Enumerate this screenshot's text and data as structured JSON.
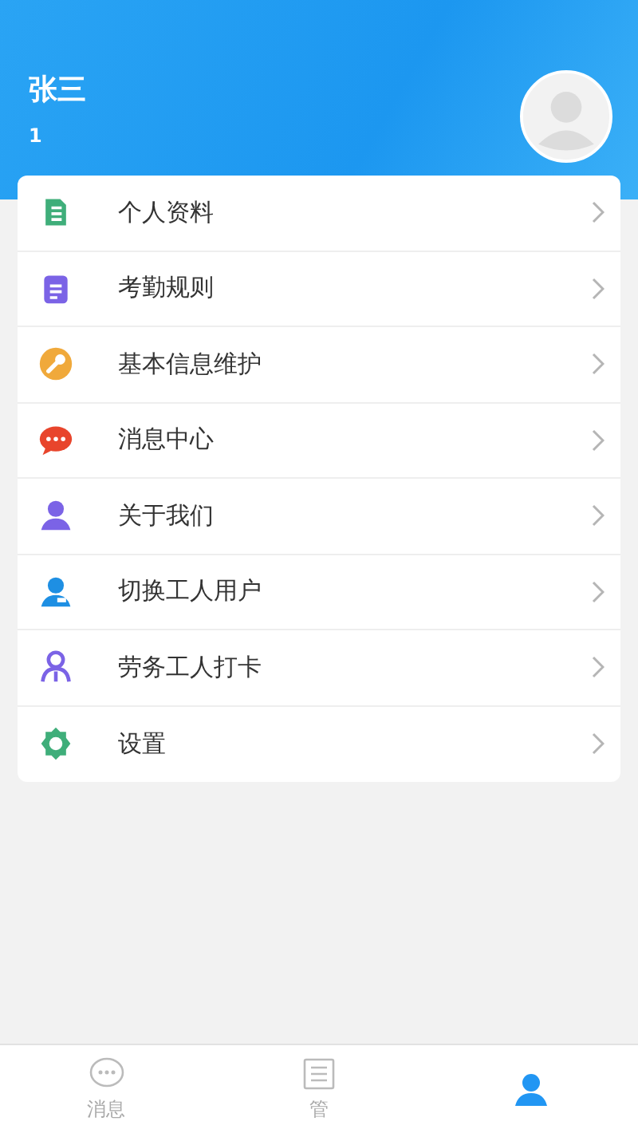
{
  "header": {
    "name": "张三",
    "id_text": "1"
  },
  "menu": [
    {
      "label": "个人资料",
      "kind": "document"
    },
    {
      "label": "考勤规则",
      "kind": "clipboard"
    },
    {
      "label": "基本信息维护",
      "kind": "wrench"
    },
    {
      "label": "消息中心",
      "kind": "chat"
    },
    {
      "label": "关于我们",
      "kind": "person"
    },
    {
      "label": "切换工人用户",
      "kind": "worker"
    },
    {
      "label": "劳务工人打卡",
      "kind": "people"
    },
    {
      "label": "设置",
      "kind": "gear"
    }
  ],
  "tab_bar": [
    {
      "label": "消息",
      "kind": "chat",
      "selected": false
    },
    {
      "label": "管",
      "kind": "list",
      "selected": false
    },
    {
      "kind": "person",
      "selected": true
    }
  ]
}
